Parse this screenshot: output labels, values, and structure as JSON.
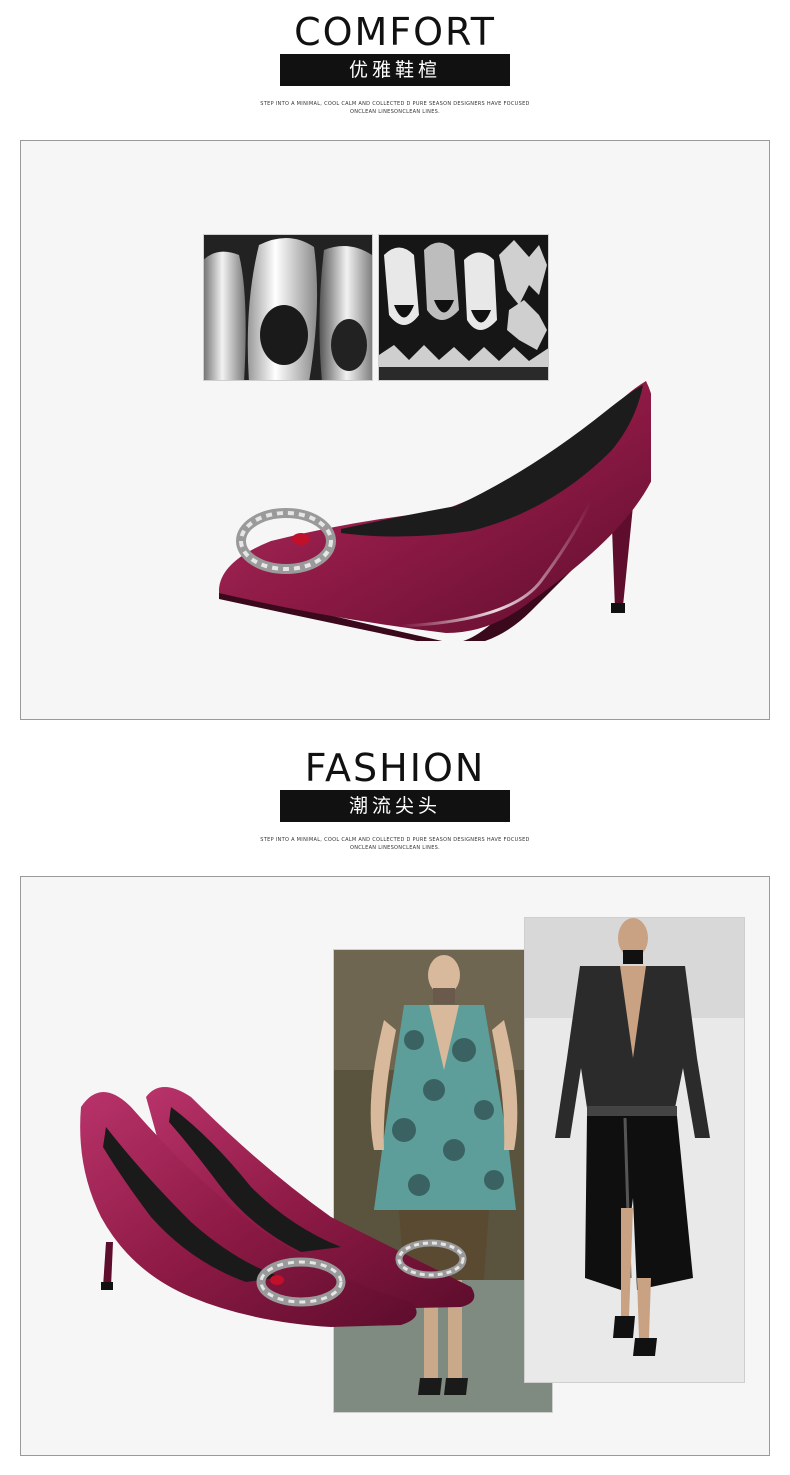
{
  "section1": {
    "title": "COMFORT",
    "subtitle": "优雅鞋楦",
    "tagline_line1": "STEP INTO A MINIMAL, COOL CALM AND COLLECTED D PURE SEASON DESIGNERS HAVE FOCUSED",
    "tagline_line2": "ONCLEAN LINESONCLEAN LINES."
  },
  "section2": {
    "title": "FASHION",
    "subtitle": "潮流尖头",
    "tagline_line1": "STEP INTO A MINIMAL, COOL CALM AND COLLECTED D PURE SEASON DESIGNERS HAVE FOCUSED",
    "tagline_line2": "ONCLEAN LINESONCLEAN LINES."
  },
  "colors": {
    "velvet": "#8e1a45",
    "velvet_dark": "#5e0d2c",
    "velvet_light": "#b8336a",
    "frame_bg": "#f6f6f6",
    "border": "#9a9a9a"
  }
}
